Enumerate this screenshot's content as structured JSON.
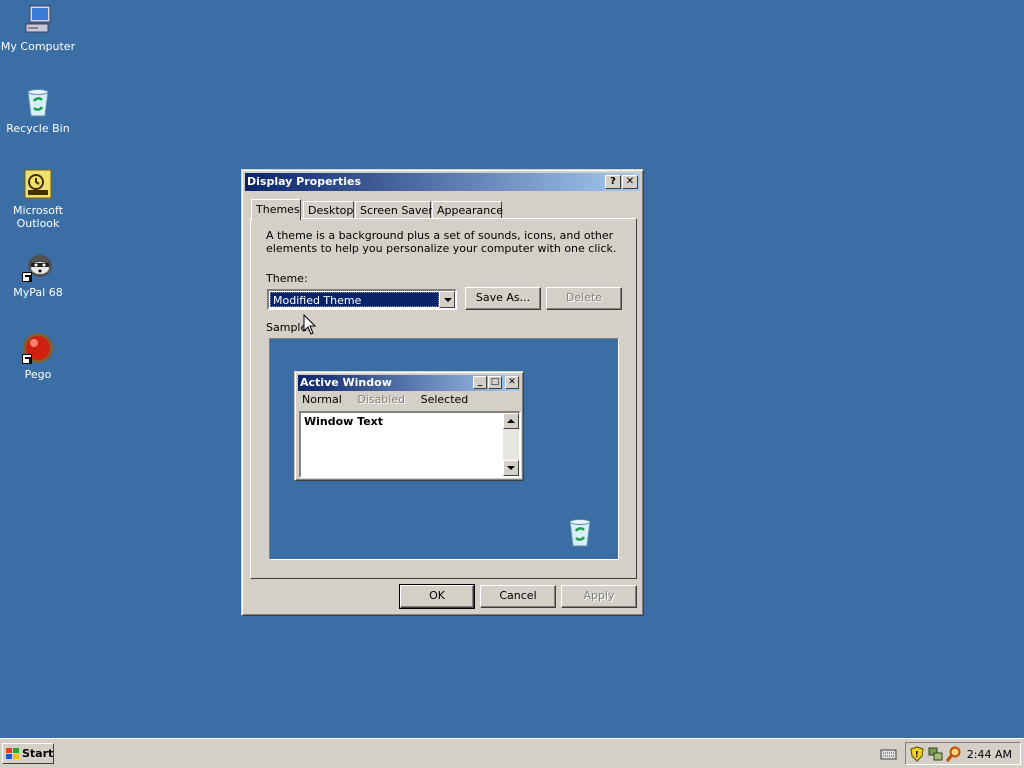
{
  "desktop": {
    "icons": [
      {
        "label": "My Computer"
      },
      {
        "label": "Recycle Bin"
      },
      {
        "label": "Microsoft\nOutlook"
      },
      {
        "label": "MyPal 68"
      },
      {
        "label": "Pego"
      }
    ],
    "background_color": "#3a6ea5"
  },
  "dialog": {
    "title": "Display Properties",
    "help_button": "?",
    "close_button": "✕",
    "tabs": [
      {
        "label": "Themes",
        "active": true
      },
      {
        "label": "Desktop",
        "active": false
      },
      {
        "label": "Screen Saver",
        "active": false
      },
      {
        "label": "Appearance",
        "active": false
      }
    ],
    "description": "A theme is a background plus a set of sounds, icons, and other elements to help you personalize your computer with one click.",
    "theme_label": "Theme:",
    "theme_value": "Modified Theme",
    "save_as_label": "Save As...",
    "delete_label": "Delete",
    "sample_label": "Sample:",
    "sample": {
      "window_title": "Active Window",
      "menu": {
        "normal": "Normal",
        "disabled": "Disabled",
        "selected": "Selected"
      },
      "window_text": "Window Text"
    },
    "ok_label": "OK",
    "cancel_label": "Cancel",
    "apply_label": "Apply"
  },
  "taskbar": {
    "start_label": "Start",
    "clock": "2:44 AM"
  }
}
